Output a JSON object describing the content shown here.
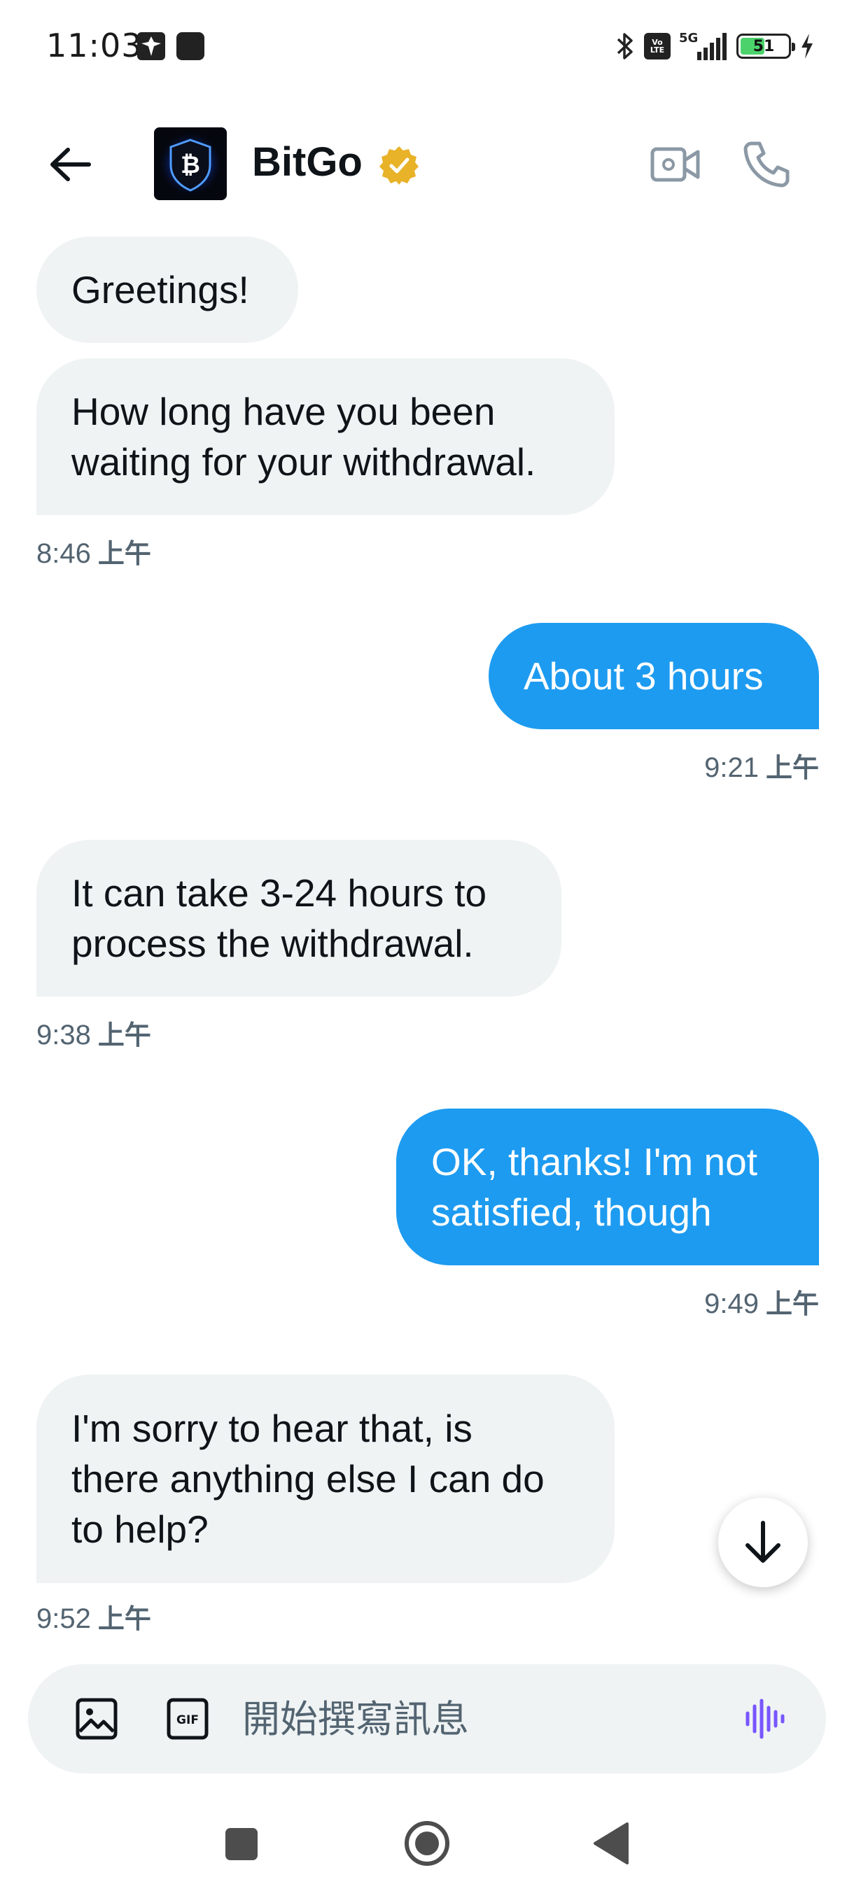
{
  "status_bar": {
    "time": "11:03",
    "network": "5G",
    "volte": "Vo LTE",
    "battery": "51",
    "battery_level": 0.51
  },
  "header": {
    "contact_name": "BitGo",
    "avatar_icon": "bitcoin-shield-logo",
    "verified_icon": "verified-badge",
    "verified_color": "#e8b229"
  },
  "messages": [
    {
      "direction": "in",
      "text": "Greetings!"
    },
    {
      "direction": "in",
      "text": "How long have you been\nwaiting for your withdrawal.",
      "time": "8:46",
      "ampm": "上午"
    },
    {
      "direction": "out",
      "text": "About 3 hours",
      "time": "9:21",
      "ampm": "上午"
    },
    {
      "direction": "in",
      "text": "It can take 3-24 hours to\nprocess the withdrawal.",
      "time": "9:38",
      "ampm": "上午"
    },
    {
      "direction": "out",
      "text": "OK, thanks! I'm not\nsatisfied, though",
      "time": "9:49",
      "ampm": "上午"
    },
    {
      "direction": "in",
      "text": "I'm sorry to hear that, is\nthere anything else I can do\nto help?",
      "time": "9:52",
      "ampm": "上午"
    }
  ],
  "composer": {
    "placeholder": "開始撰寫訊息",
    "gif_label": "GIF",
    "voice_color": "#7856ff"
  },
  "colors": {
    "outgoing_bubble": "#1d9bf0",
    "incoming_bubble": "#eff3f4",
    "timestamp": "#536471"
  }
}
